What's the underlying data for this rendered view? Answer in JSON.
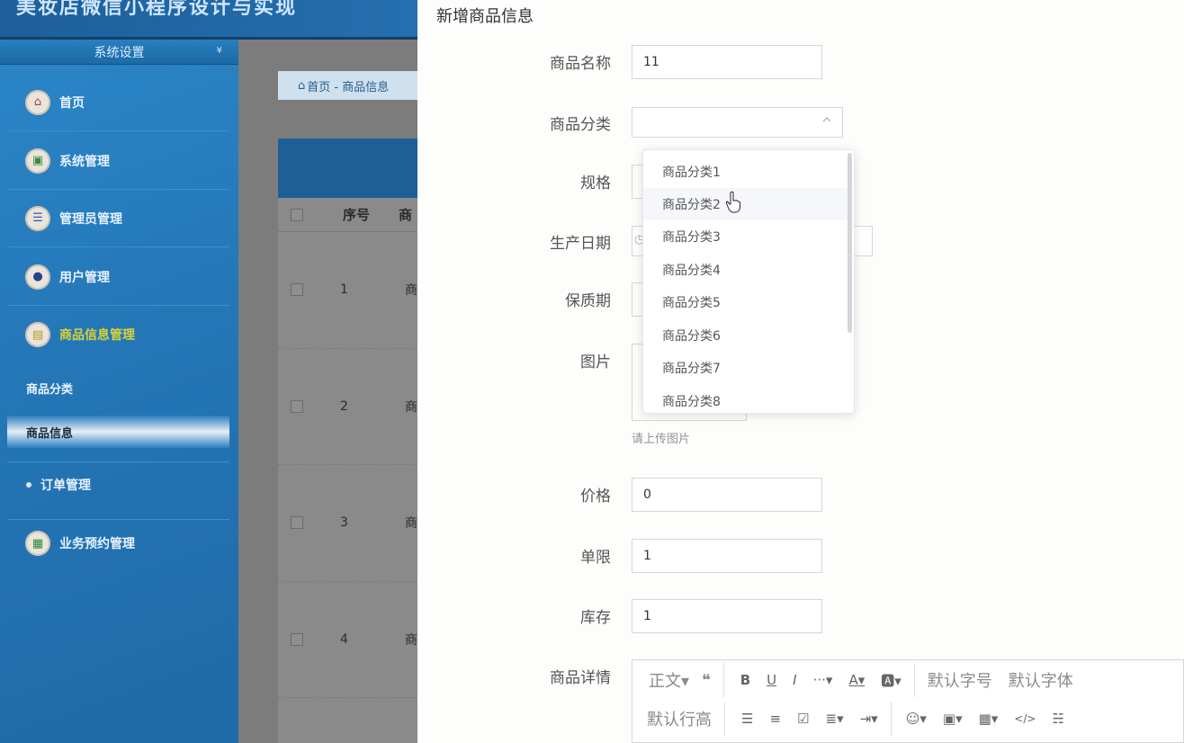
{
  "app": {
    "title": "美妆店微信小程序设计与实现"
  },
  "sidebar": {
    "header": "系统设置",
    "items": [
      {
        "label": "首页",
        "icon": "home-icon"
      },
      {
        "label": "系统管理",
        "icon": "system-icon"
      },
      {
        "label": "管理员管理",
        "icon": "admin-icon"
      },
      {
        "label": "用户管理",
        "icon": "user-icon"
      },
      {
        "label": "商品信息管理",
        "icon": "goods-icon"
      },
      {
        "label": "商品分类"
      },
      {
        "label": "商品信息"
      },
      {
        "label": "订单管理"
      },
      {
        "label": "业务预约管理",
        "icon": "booking-icon"
      }
    ]
  },
  "main": {
    "breadcrumb": "首页 - 商品信息",
    "table": {
      "headers": [
        "序号",
        "商"
      ],
      "rows": [
        {
          "no": "1",
          "name": "商"
        },
        {
          "no": "2",
          "name": "商"
        },
        {
          "no": "3",
          "name": "商"
        },
        {
          "no": "4",
          "name": "商"
        }
      ]
    }
  },
  "dialog": {
    "title": "新增商品信息",
    "fields": {
      "name": {
        "label": "商品名称",
        "value": "11"
      },
      "category": {
        "label": "商品分类",
        "value": ""
      },
      "spec": {
        "label": "规格"
      },
      "date": {
        "label": "生产日期"
      },
      "shelf": {
        "label": "保质期"
      },
      "image": {
        "label": "图片",
        "hint": "请上传图片"
      },
      "price": {
        "label": "价格",
        "value": "0"
      },
      "limit": {
        "label": "单限",
        "value": "1"
      },
      "stock": {
        "label": "库存",
        "value": "1"
      },
      "detail": {
        "label": "商品详情"
      }
    },
    "dropdown": {
      "options": [
        "商品分类1",
        "商品分类2",
        "商品分类3",
        "商品分类4",
        "商品分类5",
        "商品分类6",
        "商品分类7",
        "商品分类8"
      ],
      "hovered": "商品分类2"
    },
    "editor": {
      "row1": [
        "正文",
        "❝",
        "B",
        "U",
        "I",
        "···",
        "A",
        "🅰",
        "默认字号",
        "默认字体"
      ],
      "row2": [
        "默认行高",
        "☰",
        "≡",
        "☑",
        "≣",
        "⇥",
        "☺",
        "▣",
        "▦",
        "</>",
        "☵"
      ]
    }
  },
  "colors": {
    "sidebar": "#2476b6",
    "accent": "#d8d23a",
    "dialog_bg": "#fdfdfb"
  }
}
